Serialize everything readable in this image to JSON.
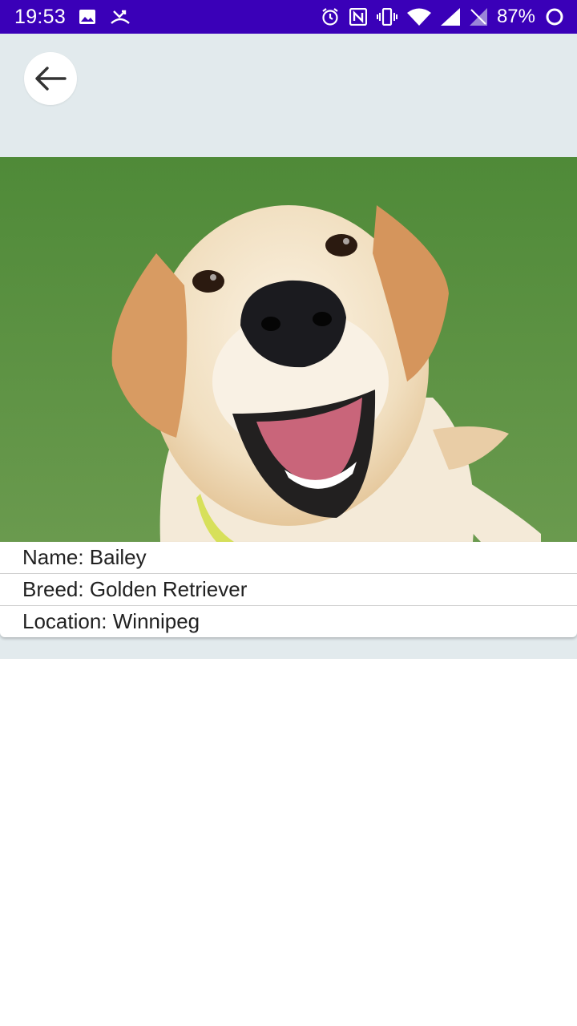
{
  "status_bar": {
    "time": "19:53",
    "battery_percent": "87%",
    "left_icons": [
      "image-icon",
      "missed-call-icon"
    ],
    "right_icons": [
      "alarm-icon",
      "nfc-icon",
      "vibrate-icon",
      "wifi-icon",
      "signal-icon",
      "no-sim-icon",
      "battery-icon"
    ],
    "background_color": "#3a00b8"
  },
  "app_bar": {
    "back_icon": "arrow-back-icon",
    "background_color": "#e2eaed"
  },
  "dog": {
    "photo_icon": "dog-photo",
    "name_line": "Name: Bailey",
    "breed_line": "Breed: Golden Retriever",
    "location_line": "Location: Winnipeg"
  }
}
